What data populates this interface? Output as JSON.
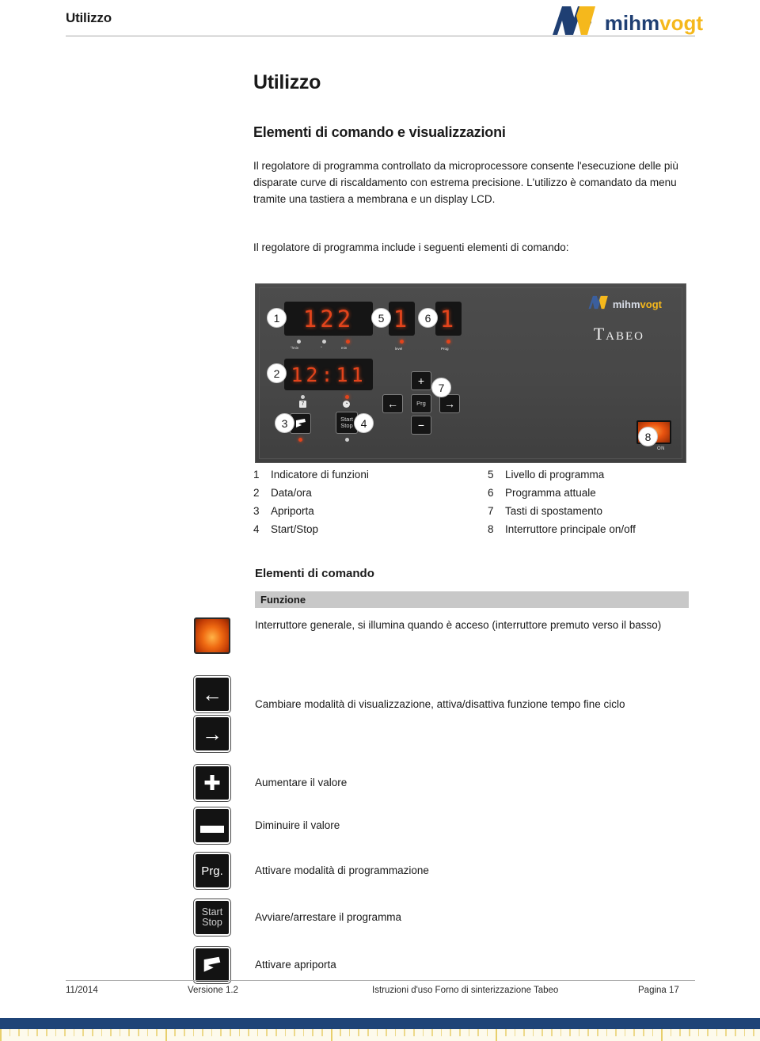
{
  "header": {
    "title": "Utilizzo",
    "logo": {
      "part1": "mihm",
      "part2": "vogt",
      "mark": "mv-monogram-icon"
    }
  },
  "content": {
    "h1": "Utilizzo",
    "h2": "Elementi di comando e visualizzazioni",
    "paragraph_1": "Il regolatore di programma controllato da microprocessore consente l'esecuzione delle più disparate curve di riscaldamento con estrema precisione. L'utilizzo è comandato da menu tramite una tastiera a membrana e un display LCD.",
    "paragraph_2": "Il regolatore di programma include i seguenti elementi di comando:"
  },
  "panel": {
    "brand_part1": "mihm",
    "brand_part2": "vogt",
    "product_name": "Tabeo",
    "display_function": "122",
    "display_datetime": "12:11",
    "display_level": "1",
    "display_program": "1",
    "micro_labels": {
      "rate": "°/min",
      "temp": "°",
      "min": "min",
      "level": "level",
      "prog": "Prog"
    },
    "keys": {
      "plus": "+",
      "minus": "−",
      "left": "←",
      "right": "→",
      "prg": "Prg",
      "start": "Start",
      "stop": "Stop",
      "door": "door-opener-icon"
    },
    "power_switch_label": "ON",
    "callouts": [
      "1",
      "2",
      "3",
      "4",
      "5",
      "6",
      "7",
      "8"
    ]
  },
  "legend": {
    "left": [
      {
        "num": "1",
        "label": "Indicatore di funzioni"
      },
      {
        "num": "2",
        "label": "Data/ora"
      },
      {
        "num": "3",
        "label": "Apriporta"
      },
      {
        "num": "4",
        "label": "Start/Stop"
      }
    ],
    "right": [
      {
        "num": "5",
        "label": "Livello di programma"
      },
      {
        "num": "6",
        "label": "Programma attuale"
      },
      {
        "num": "7",
        "label": "Tasti di spostamento"
      },
      {
        "num": "8",
        "label": "Interruttore principale on/off"
      }
    ]
  },
  "elements_table": {
    "title": "Elementi di comando",
    "header": "Funzione",
    "rows": [
      {
        "icon": "power-switch-icon",
        "text": "Interruttore generale, si illumina quando è acceso (interruttore premuto verso il basso)"
      },
      {
        "icon": "arrow-left-right-keys-icon",
        "text": "Cambiare modalità di visualizzazione, attiva/disattiva funzione tempo fine ciclo"
      },
      {
        "icon": "plus-key-icon",
        "text": "Aumentare il valore"
      },
      {
        "icon": "minus-key-icon",
        "text": "Diminuire il valore"
      },
      {
        "icon": "prg-key-icon",
        "label": "Prg.",
        "text": "Attivare modalità di programmazione"
      },
      {
        "icon": "start-stop-key-icon",
        "label_line1": "Start",
        "label_line2": "Stop",
        "text": "Avviare/arrestare il programma"
      },
      {
        "icon": "door-opener-key-icon",
        "text": "Attivare apriporta"
      }
    ]
  },
  "footer": {
    "date": "11/2014",
    "version": "Versione 1.2",
    "document": "Istruzioni d'uso Forno di sinterizzazione Tabeo",
    "page": "Pagina 17"
  },
  "colors": {
    "brand_blue": "#1f3f73",
    "brand_yellow": "#f5b81c",
    "bottom_bar": "#1f4477",
    "table_header_gray": "#c8c8c8",
    "led_red": "#e2441c"
  }
}
